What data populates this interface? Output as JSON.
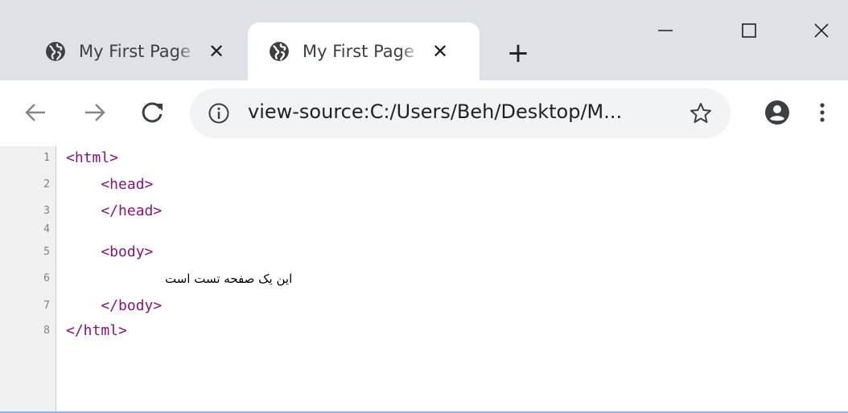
{
  "tabs": [
    {
      "title": "My First Page",
      "close": "✕",
      "active": false
    },
    {
      "title": "My First Page",
      "close": "✕",
      "active": true
    }
  ],
  "new_tab_label": "+",
  "window_controls": {
    "minimize": "minimize-icon",
    "maximize": "maximize-icon",
    "close": "close-icon"
  },
  "toolbar": {
    "back": "back-arrow-icon",
    "forward": "forward-arrow-icon",
    "reload": "reload-icon",
    "url": "view-source:C:/Users/Beh/Desktop/M...",
    "bookmark": "star-icon",
    "account": "account-icon",
    "menu": "kebab-menu-icon"
  },
  "source_lines": [
    {
      "num": "1",
      "code": "<html>",
      "text": ""
    },
    {
      "num": "2",
      "code": "    <head>",
      "text": ""
    },
    {
      "num": "3",
      "code": "    </head>",
      "text": ""
    },
    {
      "num": "4",
      "code": "",
      "text": ""
    },
    {
      "num": "5",
      "code": "    <body>",
      "text": ""
    },
    {
      "num": "6",
      "code": "",
      "text": "این یک صفحه تست است"
    },
    {
      "num": "7",
      "code": "    </body>",
      "text": ""
    },
    {
      "num": "8",
      "code": "</html>",
      "text": ""
    }
  ],
  "colors": {
    "tabstrip": "#dee1e6",
    "omnibox": "#f1f3f4",
    "tag": "#881280",
    "gutter": "#f0f0f0",
    "accent_line": "#8ab4f8"
  }
}
